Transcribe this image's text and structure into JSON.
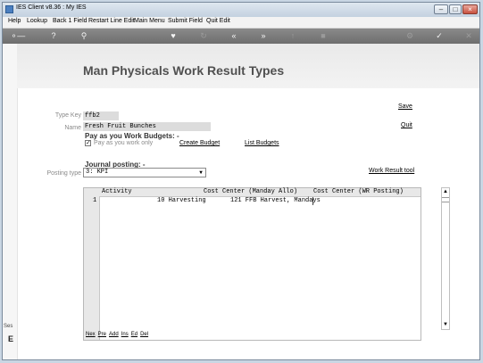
{
  "window": {
    "title": "IES Client v8.36 : My IES"
  },
  "menu": [
    "Help",
    "Lookup",
    "Back 1 Field",
    "Restart Line Edit",
    "Main Menu",
    "Submit Field",
    "Quit Edit"
  ],
  "page": {
    "title": "Man Physicals Work Result Types"
  },
  "form": {
    "type_key_label": "Type Key",
    "type_key_value": "ffb2",
    "name_label": "Name",
    "name_value": "Fresh Fruit Bunches",
    "budgets_heading": "Pay as you Work Budgets: -",
    "pay_as_you_work_only_label": "Pay as you work only",
    "pay_as_you_work_only_checked": true,
    "create_budget": "Create Budget",
    "list_budgets": "List Budgets",
    "journal_heading": "Journal posting: -",
    "posting_type_label": "Posting type",
    "posting_type_value": "3: KPI",
    "work_result_tool": "Work Result tool",
    "save": "Save",
    "quit": "Quit"
  },
  "grid": {
    "columns": [
      "Activity",
      "Cost Center (Manday Allo)",
      "Cost Center (WR Posting)"
    ],
    "rows": [
      {
        "num": "1",
        "activity": "10 Harvesting",
        "cc_manday": "121 FFB Harvest, Mandays",
        "cc_wr": ""
      }
    ]
  },
  "grid_nav": [
    "Nex",
    "Pre",
    "Add",
    "Ins",
    "Ed",
    "Del"
  ],
  "status": {
    "fragment": "Ses",
    "letter": "E"
  }
}
